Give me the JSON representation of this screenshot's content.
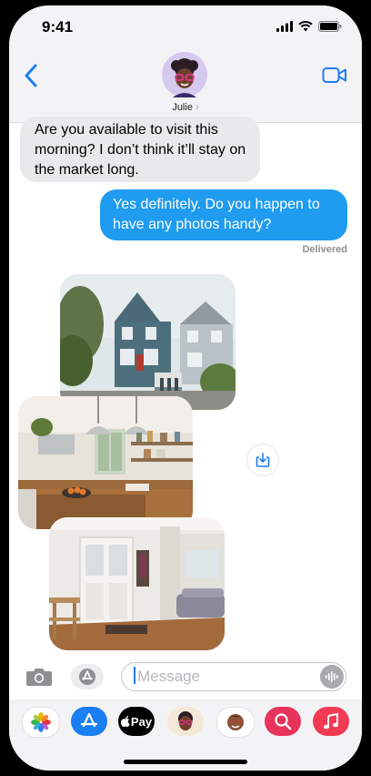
{
  "status_bar": {
    "time": "9:41"
  },
  "header": {
    "contact_name": "Julie",
    "chevron": "›"
  },
  "messages": {
    "incoming": "Are you available to visit this morning? I don’t think it’ll stay on the market long.",
    "outgoing": "Yes definitely. Do you happen to have any photos handy?",
    "status": "Delivered"
  },
  "input": {
    "placeholder": "Message"
  },
  "apps": {
    "apple_pay_label": "Pay"
  },
  "colors": {
    "bubble_out": "#1f9bf0",
    "bubble_in": "#e9e9eb",
    "accent": "#1f7cf3",
    "background_bar": "#f3f3f6"
  },
  "icons": [
    "back-chevron-icon",
    "video-call-icon",
    "camera-icon",
    "app-store-icon",
    "microphone-waveform-icon",
    "save-download-icon",
    "photos-icon",
    "apple-pay-icon",
    "memoji-icon",
    "search-images-icon",
    "music-icon"
  ]
}
